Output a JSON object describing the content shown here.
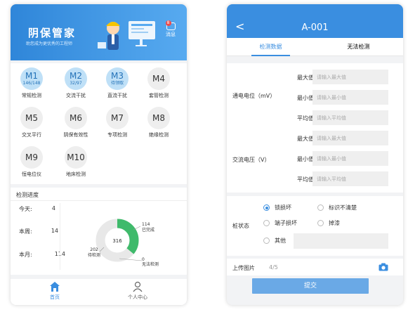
{
  "home": {
    "banner": {
      "title": "阴保管家",
      "subtitle": "助您成为更优秀的工程师",
      "message_label": "消息",
      "message_badge": "8"
    },
    "modules": [
      {
        "code": "M1",
        "sub": "146/148",
        "label": "常规检测",
        "active": true
      },
      {
        "code": "M2",
        "sub": "32/97",
        "label": "交流干扰",
        "active": true
      },
      {
        "code": "M3",
        "sub": "待领取",
        "label": "直流干扰",
        "active": true
      },
      {
        "code": "M4",
        "sub": "",
        "label": "套管检测",
        "active": false
      },
      {
        "code": "M5",
        "sub": "",
        "label": "交叉平行",
        "active": false
      },
      {
        "code": "M6",
        "sub": "",
        "label": "阴保有效性",
        "active": false
      },
      {
        "code": "M7",
        "sub": "",
        "label": "专项检测",
        "active": false
      },
      {
        "code": "M8",
        "sub": "",
        "label": "绝缘检测",
        "active": false
      },
      {
        "code": "M9",
        "sub": "",
        "label": "恒电位仪",
        "active": false
      },
      {
        "code": "M10",
        "sub": "",
        "label": "地床检测",
        "active": false
      }
    ],
    "progress": {
      "title": "检测进度",
      "stats": [
        {
          "label": "今天:",
          "value": "4"
        },
        {
          "label": "本周:",
          "value": "14"
        },
        {
          "label": "本月:",
          "value": "114"
        }
      ],
      "total": "316",
      "completed_count": "114",
      "completed_label": "已完成",
      "pending_count": "202",
      "pending_label": "待检测",
      "unable_count": "0",
      "unable_label": "无法检测",
      "completed_fraction": 0.36,
      "colors": {
        "completed": "#3fba6b",
        "pending": "#e8e8e8"
      }
    },
    "tabbar": {
      "home_label": "首页",
      "profile_label": "个人中心"
    },
    "accent": "#3a8ee0"
  },
  "detail": {
    "nav": {
      "back_symbol": "<",
      "title": "A-001"
    },
    "tabs": {
      "data_tab": "检测数据",
      "unable_tab": "无法检测"
    },
    "groups": [
      {
        "label": "通电电位（mV）",
        "rows": [
          {
            "label": "最大值",
            "placeholder": "请输入最大值"
          },
          {
            "label": "最小值",
            "placeholder": "请输入最小值"
          },
          {
            "label": "平均值",
            "placeholder": "请输入平均值"
          }
        ]
      },
      {
        "label": "交流电压（V）",
        "rows": [
          {
            "label": "最大值",
            "placeholder": "请输入最大值"
          },
          {
            "label": "最小值",
            "placeholder": "请输入最小值"
          },
          {
            "label": "平均值",
            "placeholder": "请输入平均值"
          }
        ]
      }
    ],
    "state": {
      "label": "桩状态",
      "options": [
        {
          "label": "锁损坏",
          "checked": true
        },
        {
          "label": "标识不清楚",
          "checked": false
        },
        {
          "label": "端子损坏",
          "checked": false
        },
        {
          "label": "掉漆",
          "checked": false
        },
        {
          "label": "其他",
          "checked": false
        }
      ]
    },
    "upload": {
      "label": "上传图片",
      "count": "4/5"
    },
    "submit_label": "提交"
  }
}
